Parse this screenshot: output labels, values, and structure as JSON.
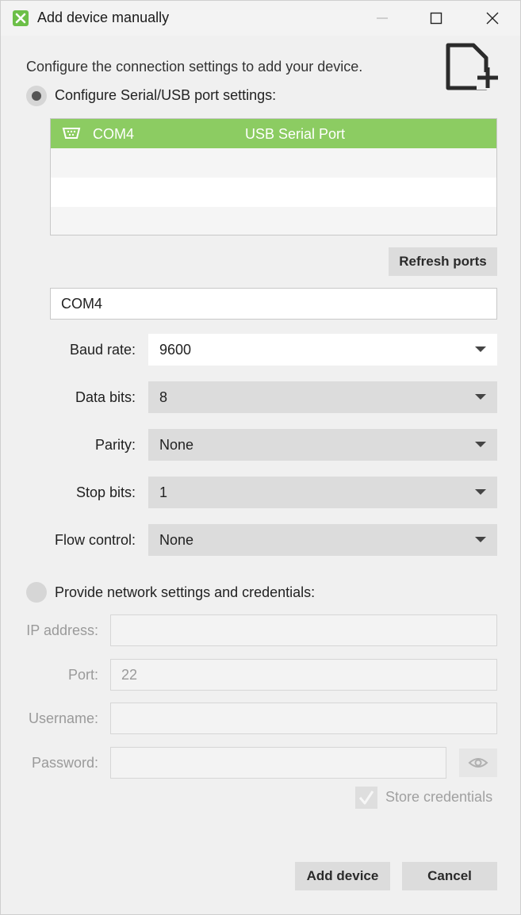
{
  "window": {
    "title": "Add device manually"
  },
  "intro_text": "Configure the connection settings to add your device.",
  "serial": {
    "radio_label": "Configure Serial/USB port settings:",
    "selected": true,
    "ports": [
      {
        "name": "COM4",
        "description": "USB Serial Port",
        "selected": true
      }
    ],
    "refresh_label": "Refresh ports",
    "port_value": "COM4",
    "settings": {
      "baud_rate": {
        "label": "Baud rate:",
        "value": "9600"
      },
      "data_bits": {
        "label": "Data bits:",
        "value": "8"
      },
      "parity": {
        "label": "Parity:",
        "value": "None"
      },
      "stop_bits": {
        "label": "Stop bits:",
        "value": "1"
      },
      "flow_control": {
        "label": "Flow control:",
        "value": "None"
      }
    }
  },
  "network": {
    "radio_label": "Provide network settings and credentials:",
    "selected": false,
    "ip_label": "IP address:",
    "ip_value": "",
    "port_label": "Port:",
    "port_value": "22",
    "username_label": "Username:",
    "username_value": "",
    "password_label": "Password:",
    "password_value": "",
    "store_credentials_label": "Store credentials",
    "store_credentials_checked": true
  },
  "buttons": {
    "add_label": "Add device",
    "cancel_label": "Cancel"
  },
  "colors": {
    "accent_green": "#8ccc62",
    "app_icon_green": "#6cbf48"
  }
}
